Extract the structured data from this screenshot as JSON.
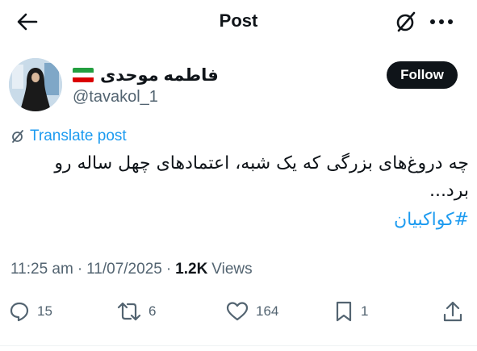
{
  "header": {
    "title": "Post",
    "back_icon": "arrow-left-icon",
    "grok_icon": "grok-icon",
    "more_icon": "more-icon"
  },
  "author": {
    "display_name": "فاطمه موحدی",
    "handle": "@tavakol_1",
    "flag_icon": "iran-flag-icon",
    "follow_label": "Follow"
  },
  "translate": {
    "label": "Translate post"
  },
  "post": {
    "text": "چه دروغ‌های بزرگی که یک شبه، اعتمادهای چهل ساله رو برد...",
    "hashtag": "#کواکبیان"
  },
  "meta": {
    "time": "11:25 am",
    "date": "11/07/2025",
    "views_count": "1.2K",
    "views_label": "Views",
    "separator": "·"
  },
  "actions": {
    "replies": "15",
    "reposts": "6",
    "likes": "164",
    "bookmarks": "1"
  },
  "colors": {
    "accent": "#1d9bf0",
    "text": "#0f1419",
    "muted": "#536471",
    "follow_bg": "#0f1419"
  }
}
